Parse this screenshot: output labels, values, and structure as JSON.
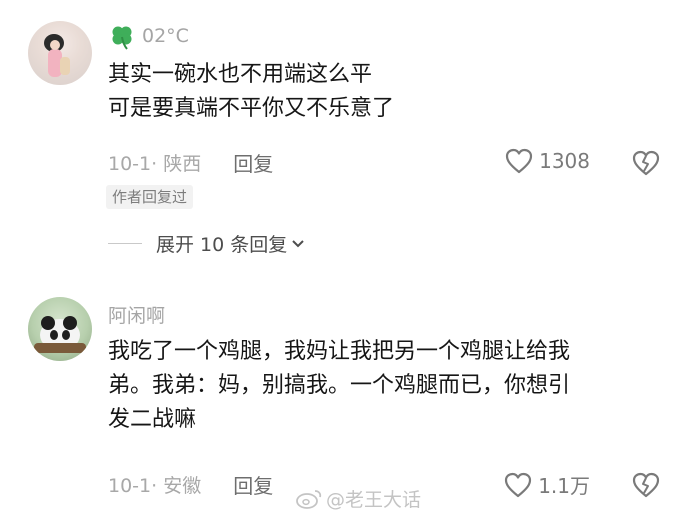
{
  "comments": [
    {
      "username": "02°C",
      "lines": [
        "其实一碗水也不用端这么平",
        "可是要真端不平你又不乐意了"
      ],
      "date_location": "10-1· 陕西",
      "reply_label": "回复",
      "like_count": "1308",
      "author_badge": "作者回复过",
      "expand_label": "展开 10 条回复"
    },
    {
      "username": "阿闲啊",
      "lines": [
        "我吃了一个鸡腿，我妈让我把另一个鸡腿让给我",
        "弟。我弟：妈，别搞我。一个鸡腿而已，你想引",
        "发二战嘛"
      ],
      "date_location": "10-1· 安徽",
      "reply_label": "回复",
      "like_count": "1.1万"
    }
  ],
  "watermark": "@老王大话",
  "icons": {
    "clover": "four-leaf-clover-icon",
    "like": "heart-outline-icon",
    "dislike": "broken-heart-icon",
    "expand": "chevron-down-icon",
    "watermark": "weibo-logo-icon"
  },
  "colors": {
    "clover": "#3fae5a",
    "meta": "#a8a8a8"
  }
}
